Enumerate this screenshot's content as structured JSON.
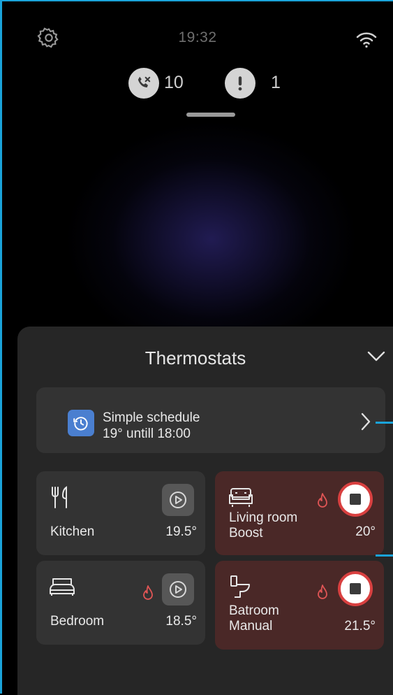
{
  "status_bar": {
    "time": "19:32",
    "settings_icon": "gear-icon",
    "wifi_icon": "wifi-icon"
  },
  "notifications": {
    "missed_calls": "10",
    "alerts": "1"
  },
  "panel": {
    "title": "Thermostats",
    "schedule": {
      "title": "Simple schedule",
      "subtitle": "19° untill 18:00"
    },
    "rooms": [
      {
        "name": "Kitchen",
        "temperature": "19.5°",
        "icon": "fork-knife-icon",
        "state": "idle"
      },
      {
        "name": "Living room",
        "mode": "Boost",
        "temperature": "20°",
        "icon": "sofa-icon",
        "state": "heating"
      },
      {
        "name": "Bedroom",
        "temperature": "18.5°",
        "icon": "bed-icon",
        "state": "idle"
      },
      {
        "name": "Batroom",
        "mode": "Manual",
        "temperature": "21.5°",
        "icon": "toilet-icon",
        "state": "heating"
      }
    ]
  },
  "colors": {
    "accent_blue": "#4a7fd0",
    "heating_tile": "#4a2827",
    "flame": "#e05555",
    "highlight_edge": "#1aa3d9"
  }
}
